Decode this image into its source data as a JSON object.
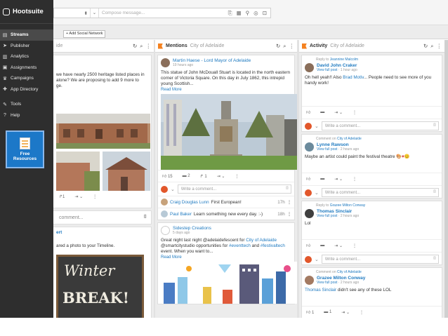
{
  "app": {
    "brand": "Hootsuite"
  },
  "compose": {
    "placeholder": "Compose message...",
    "tool_icons": [
      "paperclip-icon",
      "calendar-icon",
      "location-icon",
      "target-icon",
      "lock-icon"
    ]
  },
  "tabs": {
    "partial_label": "em",
    "add_label": "+ Add Social Network"
  },
  "sidebar": {
    "items": [
      {
        "label": "Streams",
        "icon": "streams-icon"
      },
      {
        "label": "Publisher",
        "icon": "paper-plane-icon"
      },
      {
        "label": "Analytics",
        "icon": "bar-chart-icon"
      },
      {
        "label": "Assignments",
        "icon": "clipboard-icon"
      },
      {
        "label": "Campaigns",
        "icon": "trophy-icon"
      },
      {
        "label": "App Directory",
        "icon": "puzzle-icon"
      },
      {
        "label": "Tools",
        "icon": "wrench-icon"
      },
      {
        "label": "Help",
        "icon": "help-icon"
      }
    ],
    "free_resources": {
      "line1": "Free",
      "line2": "Resources"
    }
  },
  "col1": {
    "sub": "ide",
    "post_text1": "we have nearly 2500 heritage listed places in",
    "post_text2": "alone? We are proposing to add 9 more to",
    "post_text3": "ge.",
    "comment_placeholder": "comment...",
    "post2_title": "ert",
    "post2_text": "ared a photo to your Timeline.",
    "winter1": "Winter",
    "winter2": "BREAK!"
  },
  "mentions": {
    "title": "Mentions",
    "sub": "City of Adelaide",
    "post1": {
      "author": "Martin Haese - Lord Mayor of Adelaide",
      "time": "19 hours ago",
      "text": "This statue of John McDouall Stuart is located in the north eastern corner of Victoria Square. On this day in July 1862, this intrepid young Scottish...",
      "more": "Read More",
      "likes": "15",
      "comments": "2",
      "shares": "1"
    },
    "comment_placeholder": "Write a comment...",
    "replies": [
      {
        "author": "Craig Douglas Lunn",
        "text": "First European!",
        "time": "17h"
      },
      {
        "author": "Paul Baker",
        "text": "Learn something new every day. :-)",
        "time": "18h"
      }
    ],
    "post2": {
      "author": "Sidestep Creations",
      "time": "5 days ago",
      "text_a": "Great night last night @adelaidefescent for ",
      "text_link1": "City of Adelaide",
      "text_b": " @smartcitystudio opportunities for ",
      "text_link2": "#eventtech",
      "text_c": " and ",
      "text_link3": "#festivaltech",
      "text_d": " event. When you want to...",
      "more": "Read More"
    }
  },
  "activity": {
    "title": "Activity",
    "sub": "City of Adelaide",
    "items": [
      {
        "context_pre": "Reply to ",
        "context_name": "Jeannine Malcolm",
        "author": "David John Craker",
        "view": "View full post",
        "time": "1 hour ago",
        "text_a": "Oh hell yeah!! Also ",
        "text_link": "Brad Motiv",
        "text_b": "... People need to see more of you handy work!",
        "comment_placeholder": "Write a comment..."
      },
      {
        "context_pre": "Comment on ",
        "context_name": "City of Adelaide",
        "author": "Lynne Rawson",
        "view": "View full post",
        "time": "2 hours ago",
        "text_a": "Maybe an artist could paint the festival theatre ",
        "text_link": "",
        "text_b": "",
        "comment_placeholder": "Write a comment..."
      },
      {
        "context_pre": "Reply to ",
        "context_name": "Grazee Milton Conway",
        "author": "Thomas Sinclair",
        "view": "View full post",
        "time": "2 hours ago",
        "text_a": "Lol",
        "text_link": "",
        "text_b": "",
        "comment_placeholder": "Write a comment..."
      },
      {
        "context_pre": "Comment on ",
        "context_name": "City of Adelaide",
        "author": "Grazee Milton Conway",
        "view": "View full post",
        "time": "2 hours ago",
        "text_a": "",
        "text_link": "Thomas Sinclair",
        "text_b": " didn't see any of these LOL",
        "likes": "1",
        "comments": "1"
      }
    ]
  }
}
